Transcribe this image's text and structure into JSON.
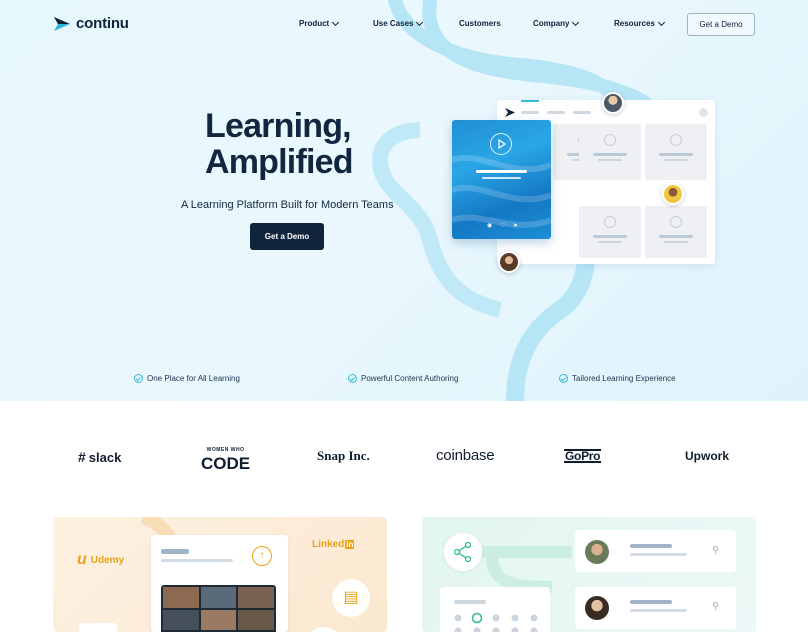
{
  "brand": {
    "name": "continu"
  },
  "nav": {
    "items": [
      {
        "label": "Product",
        "dropdown": true
      },
      {
        "label": "Use Cases",
        "dropdown": true
      },
      {
        "label": "Customers",
        "dropdown": false
      },
      {
        "label": "Company",
        "dropdown": true
      },
      {
        "label": "Resources",
        "dropdown": true
      }
    ],
    "demo_label": "Get a Demo"
  },
  "hero": {
    "title_line1": "Learning,",
    "title_line2": "Amplified",
    "subtitle": "A Learning Platform Built for Modern Teams",
    "cta_label": "Get a Demo",
    "features": [
      "One Place for All Learning",
      "Powerful Content Authoring",
      "Tailored Learning Experience"
    ]
  },
  "logos": [
    "slack",
    "WOMEN WHO",
    "CODE",
    "Snap Inc.",
    "coinbase",
    "GoPro",
    "Upwork"
  ],
  "integrations": {
    "udemy": "Udemy",
    "linkedin": "Linked"
  },
  "colors": {
    "navy": "#10243c",
    "accent": "#3bb7d8",
    "river": "#b6e6f6"
  }
}
